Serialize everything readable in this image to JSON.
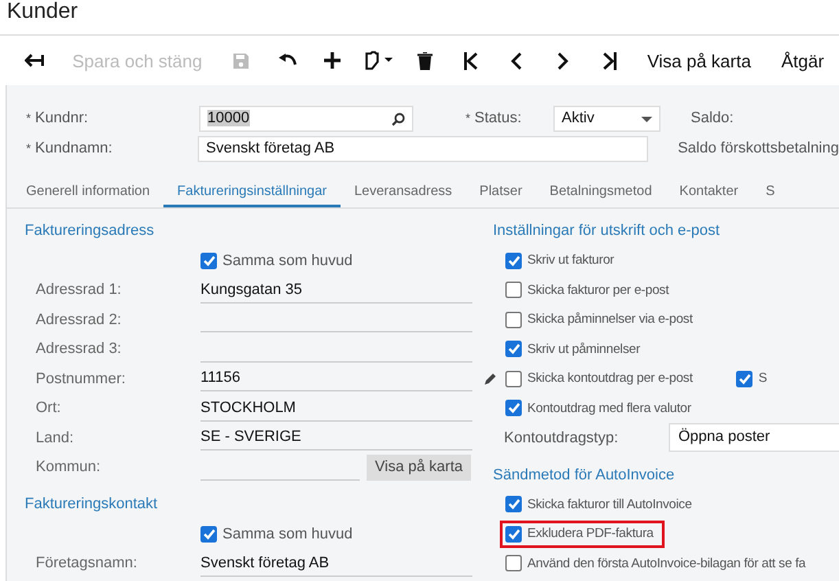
{
  "title": "Kunder",
  "toolbar": [
    {
      "kind": "back",
      "disabled": false
    },
    {
      "kind": "text",
      "label": "Spara och stäng",
      "disabled": true
    },
    {
      "kind": "save",
      "disabled": true
    },
    {
      "kind": "undo",
      "disabled": false
    },
    {
      "kind": "add",
      "disabled": false
    },
    {
      "kind": "paste",
      "disabled": false
    },
    {
      "kind": "delete",
      "disabled": false
    },
    {
      "kind": "first",
      "disabled": false
    },
    {
      "kind": "prev",
      "disabled": false
    },
    {
      "kind": "next",
      "disabled": false
    },
    {
      "kind": "last",
      "disabled": false
    },
    {
      "kind": "text",
      "label": "Visa på karta",
      "disabled": false
    },
    {
      "kind": "text",
      "label": "Åtgär",
      "disabled": false
    }
  ],
  "header": {
    "customer_no": {
      "marker": "*",
      "label": "Kundnr:",
      "value": "10000"
    },
    "status": {
      "marker": "*",
      "label": "Status:",
      "value": "Aktiv"
    },
    "customer_name": {
      "marker": "*",
      "label": "Kundnamn:",
      "value": "Svenskt företag AB"
    },
    "balance": {
      "label": "Saldo:"
    },
    "prepayment_balance": {
      "label": "Saldo förskottsbetalning"
    }
  },
  "tabs": [
    {
      "label": "Generell information",
      "selected": false
    },
    {
      "label": "Faktureringsinställningar",
      "selected": true
    },
    {
      "label": "Leveransadress",
      "selected": false
    },
    {
      "label": "Platser",
      "selected": false
    },
    {
      "label": "Betalningsmetod",
      "selected": false
    },
    {
      "label": "Kontakter",
      "selected": false
    },
    {
      "label": "S",
      "selected": false
    }
  ],
  "billing_address": {
    "heading": "Faktureringsadress",
    "same_as_main": {
      "label": "Samma som huvud",
      "checked": true
    },
    "rows": [
      {
        "label": "Adressrad 1:",
        "value": "Kungsgatan 35"
      },
      {
        "label": "Adressrad 2:"
      },
      {
        "label": "Adressrad 3:"
      },
      {
        "label": "Postnummer:",
        "value": "11156"
      },
      {
        "label": "Ort:",
        "value": "STOCKHOLM"
      },
      {
        "label": "Land:",
        "value": "SE - SVERIGE"
      },
      {
        "label": "Kommun:"
      }
    ],
    "map_button": "Visa på karta"
  },
  "billing_contact": {
    "heading": "Faktureringskontakt",
    "same_as_main": {
      "label": "Samma som huvud",
      "checked": true
    },
    "rows": [
      {
        "label": "Företagsnamn:",
        "value": "Svenskt företag AB"
      }
    ]
  },
  "print_email": {
    "heading": "Inställningar för utskrift och e-post",
    "options": [
      {
        "label": "Skriv ut fakturor",
        "checked": true
      },
      {
        "label": "Skicka fakturor per e-post",
        "checked": false
      },
      {
        "label": "Skicka påminnelser via e-post",
        "checked": false
      },
      {
        "label": "Skriv ut påminnelser",
        "checked": true
      },
      {
        "label": "Skicka kontoutdrag per e-post",
        "checked": false,
        "side": {
          "label": "S",
          "checked": true
        }
      },
      {
        "label": "Kontoutdrag med flera valutor",
        "checked": true
      }
    ],
    "statement_type": {
      "label": "Kontoutdragstyp:",
      "value": "Öppna poster"
    }
  },
  "autoinvoice": {
    "heading": "Sändmetod för AutoInvoice",
    "options": [
      {
        "label": "Skicka fakturor till AutoInvoice",
        "checked": true
      },
      {
        "label": "Exkludera PDF-faktura",
        "checked": true,
        "highlighted": true
      },
      {
        "label": "Använd den första AutoInvoice-bilagan för att se fa",
        "checked": false
      }
    ]
  }
}
